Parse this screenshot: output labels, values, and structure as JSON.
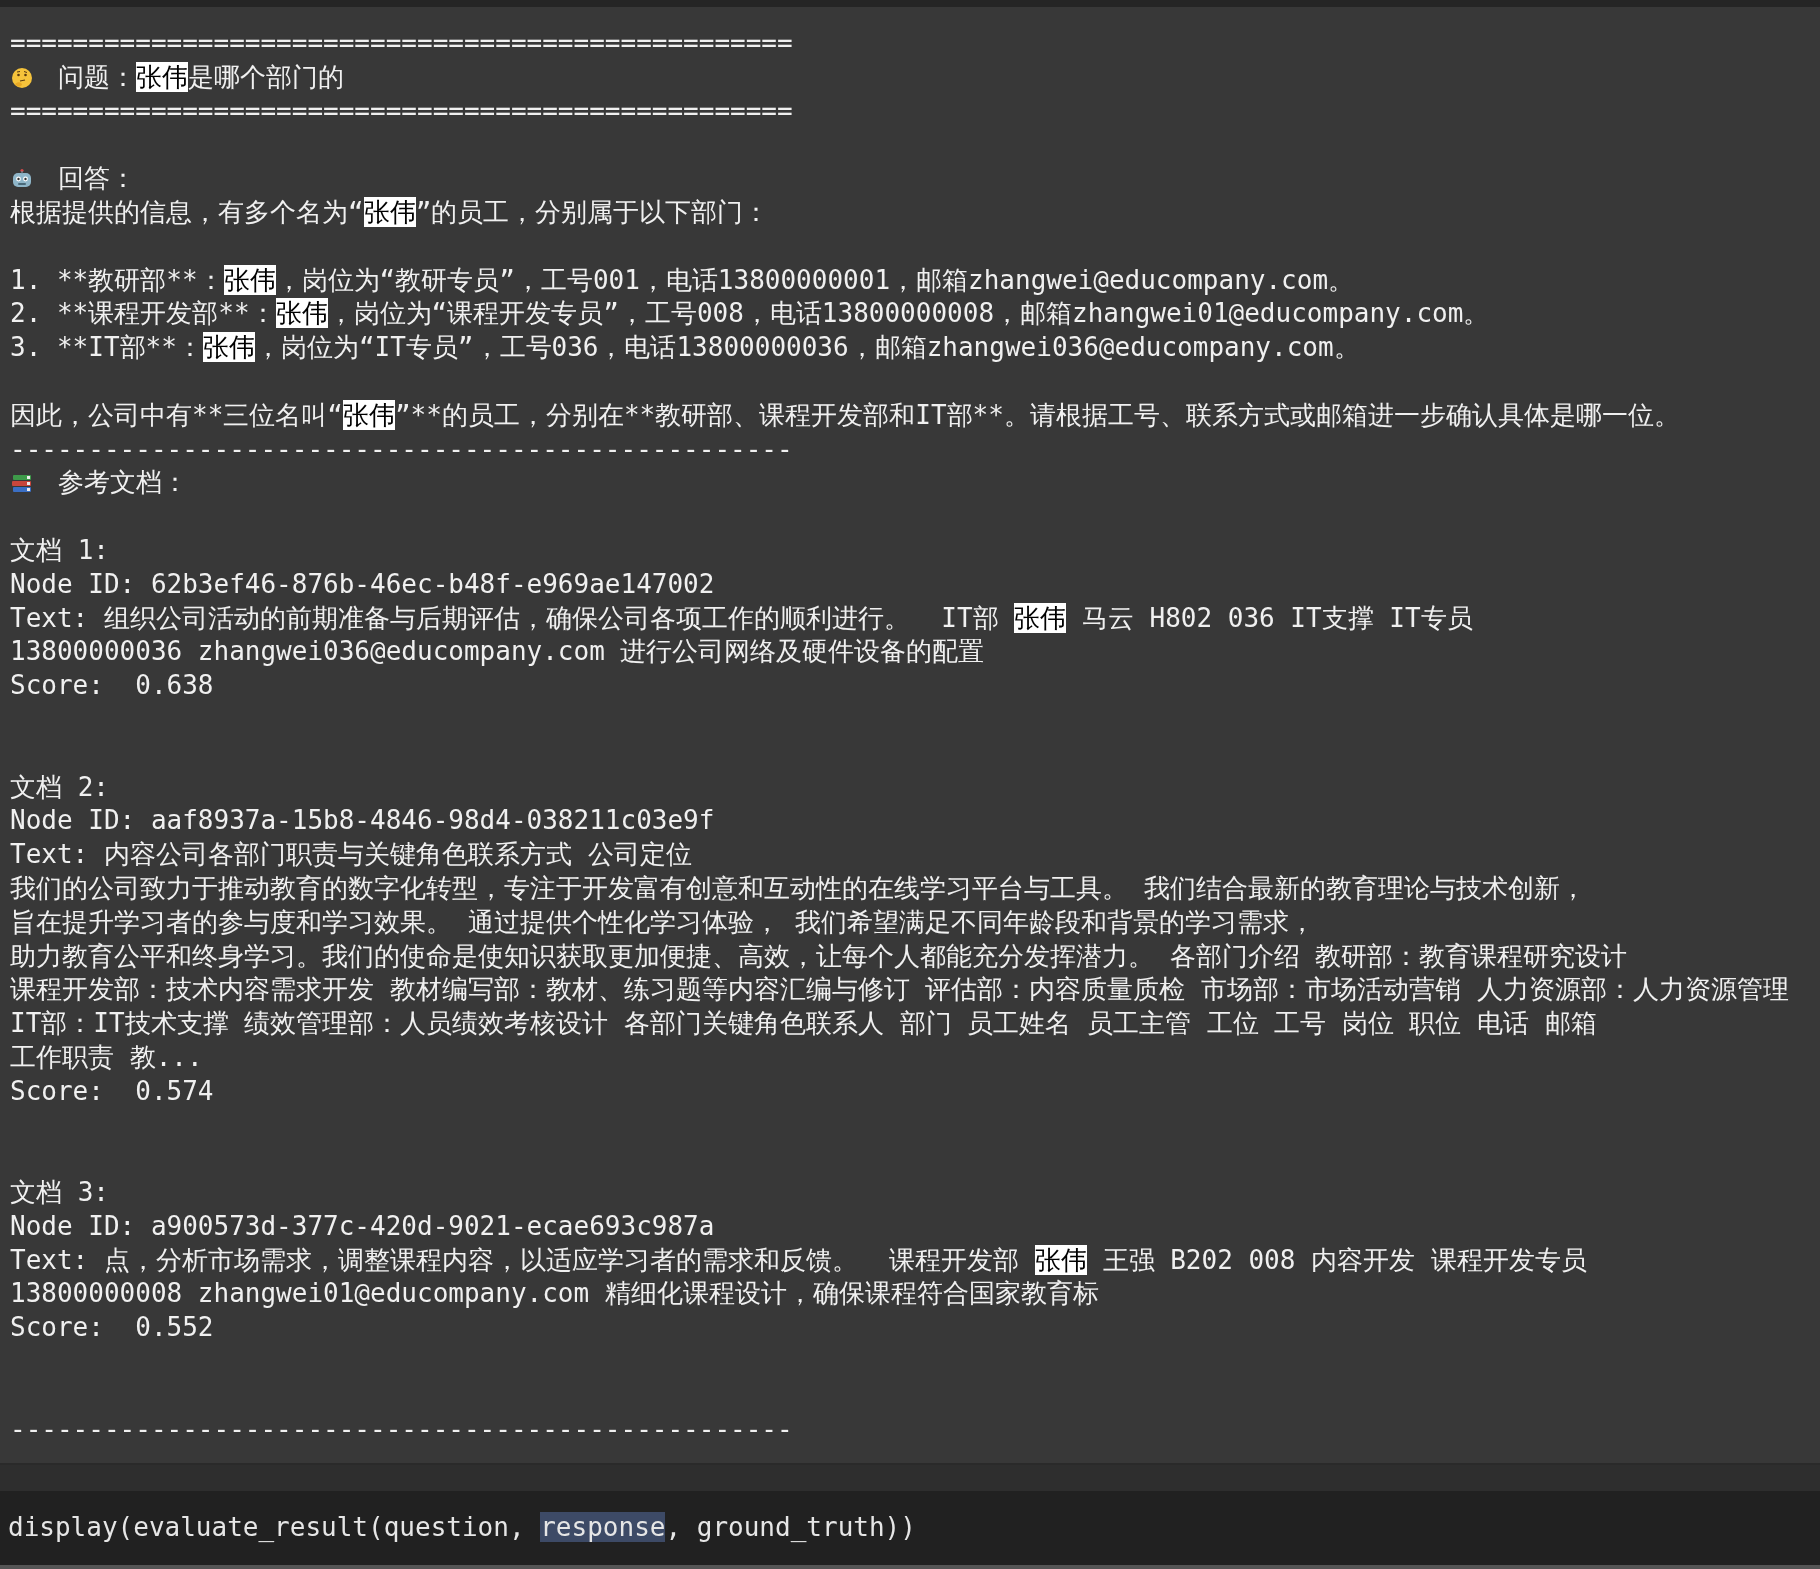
{
  "output_lines": [
    {
      "kind": "text",
      "parts": [
        {
          "text": "==================================================",
          "highlighted": false
        }
      ]
    },
    {
      "kind": "question",
      "parts": [
        {
          "text": " 问题：",
          "highlighted": false
        },
        {
          "text": "张伟",
          "highlighted": true
        },
        {
          "text": "是哪个部门的",
          "highlighted": false
        }
      ]
    },
    {
      "kind": "text",
      "parts": [
        {
          "text": "==================================================",
          "highlighted": false
        }
      ]
    },
    {
      "kind": "blank"
    },
    {
      "kind": "answer",
      "parts": [
        {
          "text": " 回答：",
          "highlighted": false
        }
      ]
    },
    {
      "kind": "text",
      "parts": [
        {
          "text": "根据提供的信息，有多个名为“",
          "highlighted": false
        },
        {
          "text": "张伟",
          "highlighted": true
        },
        {
          "text": "”的员工，分别属于以下部门：",
          "highlighted": false
        }
      ]
    },
    {
      "kind": "blank"
    },
    {
      "kind": "text",
      "parts": [
        {
          "text": "1. **教研部**：",
          "highlighted": false
        },
        {
          "text": "张伟",
          "highlighted": true
        },
        {
          "text": "，岗位为“教研专员”，工号001，电话13800000001，邮箱zhangwei@educompany.com。",
          "highlighted": false
        }
      ]
    },
    {
      "kind": "text",
      "parts": [
        {
          "text": "2. **课程开发部**：",
          "highlighted": false
        },
        {
          "text": "张伟",
          "highlighted": true
        },
        {
          "text": "，岗位为“课程开发专员”，工号008，电话13800000008，邮箱zhangwei01@educompany.com。",
          "highlighted": false
        }
      ]
    },
    {
      "kind": "text",
      "parts": [
        {
          "text": "3. **IT部**：",
          "highlighted": false
        },
        {
          "text": "张伟",
          "highlighted": true
        },
        {
          "text": "，岗位为“IT专员”，工号036，电话13800000036，邮箱zhangwei036@educompany.com。",
          "highlighted": false
        }
      ]
    },
    {
      "kind": "blank"
    },
    {
      "kind": "text",
      "parts": [
        {
          "text": "因此，公司中有**三位名叫“",
          "highlighted": false
        },
        {
          "text": "张伟",
          "highlighted": true
        },
        {
          "text": "”**的员工，分别在**教研部、课程开发部和IT部**。请根据工号、联系方式或邮箱进一步确认具体是哪一位。",
          "highlighted": false
        }
      ]
    },
    {
      "kind": "text",
      "parts": [
        {
          "text": "--------------------------------------------------",
          "highlighted": false
        }
      ]
    },
    {
      "kind": "documents",
      "parts": [
        {
          "text": " 参考文档：",
          "highlighted": false
        }
      ]
    },
    {
      "kind": "blank"
    },
    {
      "kind": "text",
      "parts": [
        {
          "text": "文档 1:",
          "highlighted": false
        }
      ]
    },
    {
      "kind": "text",
      "parts": [
        {
          "text": "Node ID: 62b3ef46-876b-46ec-b48f-e969ae147002",
          "highlighted": false
        }
      ]
    },
    {
      "kind": "text",
      "parts": [
        {
          "text": "Text: 组织公司活动的前期准备与后期评估，确保公司各项工作的顺利进行。  IT部 ",
          "highlighted": false
        },
        {
          "text": "张伟",
          "highlighted": true
        },
        {
          "text": " 马云 H802 036 IT支撑 IT专员",
          "highlighted": false
        }
      ]
    },
    {
      "kind": "text",
      "parts": [
        {
          "text": "13800000036 zhangwei036@educompany.com 进行公司网络及硬件设备的配置",
          "highlighted": false
        }
      ]
    },
    {
      "kind": "text",
      "parts": [
        {
          "text": "Score:  0.638",
          "highlighted": false
        }
      ]
    },
    {
      "kind": "blank"
    },
    {
      "kind": "blank"
    },
    {
      "kind": "text",
      "parts": [
        {
          "text": "文档 2:",
          "highlighted": false
        }
      ]
    },
    {
      "kind": "text",
      "parts": [
        {
          "text": "Node ID: aaf8937a-15b8-4846-98d4-038211c03e9f",
          "highlighted": false
        }
      ]
    },
    {
      "kind": "text",
      "parts": [
        {
          "text": "Text: 内容公司各部门职责与关键角色联系方式 公司定位",
          "highlighted": false
        }
      ]
    },
    {
      "kind": "text",
      "parts": [
        {
          "text": "我们的公司致力于推动教育的数字化转型，专注于开发富有创意和互动性的在线学习平台与工具。 我们结合最新的教育理论与技术创新，",
          "highlighted": false
        }
      ]
    },
    {
      "kind": "text",
      "parts": [
        {
          "text": "旨在提升学习者的参与度和学习效果。 通过提供个性化学习体验， 我们希望满足不同年龄段和背景的学习需求，",
          "highlighted": false
        }
      ]
    },
    {
      "kind": "text",
      "parts": [
        {
          "text": "助力教育公平和终身学习。我们的使命是使知识获取更加便捷、高效，让每个人都能充分发挥潜力。 各部门介绍 教研部：教育课程研究设计",
          "highlighted": false
        }
      ]
    },
    {
      "kind": "text",
      "parts": [
        {
          "text": "课程开发部：技术内容需求开发 教材编写部：教材、练习题等内容汇编与修订 评估部：内容质量质检 市场部：市场活动营销 人力资源部：人力资源管理",
          "highlighted": false
        }
      ]
    },
    {
      "kind": "text",
      "parts": [
        {
          "text": "IT部：IT技术支撑 绩效管理部：人员绩效考核设计 各部门关键角色联系人 部门 员工姓名 员工主管 工位 工号 岗位 职位 电话 邮箱",
          "highlighted": false
        }
      ]
    },
    {
      "kind": "text",
      "parts": [
        {
          "text": "工作职责 教...",
          "highlighted": false
        }
      ]
    },
    {
      "kind": "text",
      "parts": [
        {
          "text": "Score:  0.574",
          "highlighted": false
        }
      ]
    },
    {
      "kind": "blank"
    },
    {
      "kind": "blank"
    },
    {
      "kind": "text",
      "parts": [
        {
          "text": "文档 3:",
          "highlighted": false
        }
      ]
    },
    {
      "kind": "text",
      "parts": [
        {
          "text": "Node ID: a900573d-377c-420d-9021-ecae693c987a",
          "highlighted": false
        }
      ]
    },
    {
      "kind": "text",
      "parts": [
        {
          "text": "Text: 点，分析市场需求，调整课程内容，以适应学习者的需求和反馈。  课程开发部 ",
          "highlighted": false
        },
        {
          "text": "张伟",
          "highlighted": true
        },
        {
          "text": " 王强 B202 008 内容开发 课程开发专员",
          "highlighted": false
        }
      ]
    },
    {
      "kind": "text",
      "parts": [
        {
          "text": "13800000008 zhangwei01@educompany.com 精细化课程设计，确保课程符合国家教育标",
          "highlighted": false
        }
      ]
    },
    {
      "kind": "text",
      "parts": [
        {
          "text": "Score:  0.552",
          "highlighted": false
        }
      ]
    },
    {
      "kind": "blank"
    },
    {
      "kind": "blank"
    },
    {
      "kind": "text",
      "parts": [
        {
          "text": "--------------------------------------------------",
          "highlighted": false
        }
      ]
    }
  ],
  "code_cell": {
    "parts": [
      {
        "text": "display(evaluate_result(question, ",
        "highlighted": false
      },
      {
        "text": "response",
        "highlighted": true
      },
      {
        "text": ", ground_truth))",
        "highlighted": false
      }
    ]
  }
}
